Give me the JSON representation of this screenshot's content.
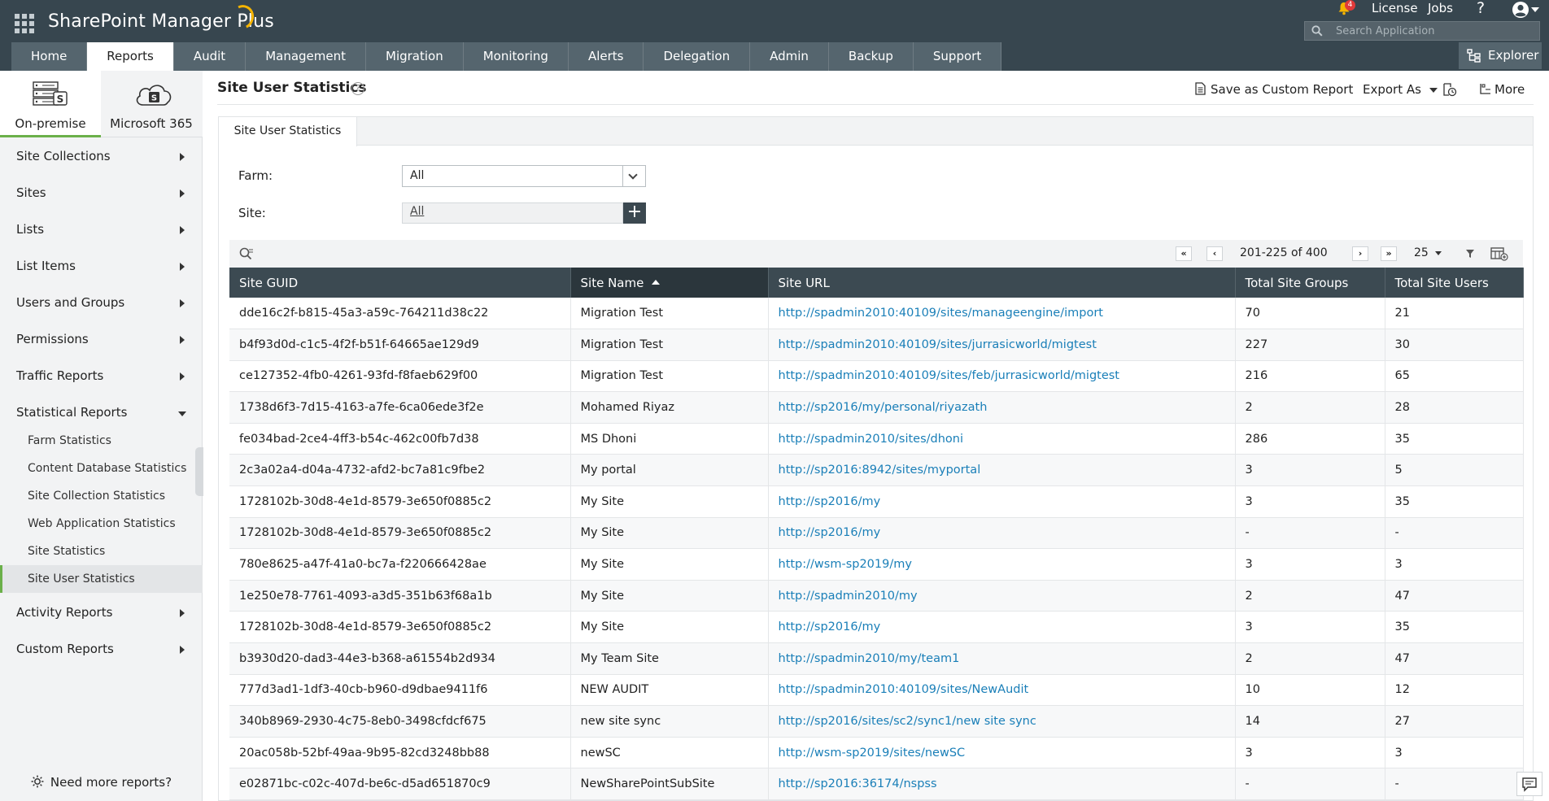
{
  "app": {
    "title": "SharePoint Manager Plus",
    "notification_count": "4",
    "license_label": "License",
    "jobs_label": "Jobs",
    "help_label": "?",
    "search_placeholder": "Search Application",
    "explorer_label": "Explorer"
  },
  "tabs": [
    "Home",
    "Reports",
    "Audit",
    "Management",
    "Migration",
    "Monitoring",
    "Alerts",
    "Delegation",
    "Admin",
    "Backup",
    "Support"
  ],
  "active_tab": "Reports",
  "sidebar": {
    "env_tabs": [
      "On-premise",
      "Microsoft 365"
    ],
    "items": [
      "Site Collections",
      "Sites",
      "Lists",
      "List Items",
      "Users and Groups",
      "Permissions",
      "Traffic Reports",
      "Statistical Reports"
    ],
    "sub_items": [
      "Farm Statistics",
      "Content Database Statistics",
      "Site Collection Statistics",
      "Web Application Statistics",
      "Site Statistics",
      "Site User Statistics"
    ],
    "active_sub_item": "Site User Statistics",
    "items_after": [
      "Activity Reports",
      "Custom Reports"
    ],
    "need_more": "Need more reports?"
  },
  "header": {
    "title": "Site User Statistics",
    "help": "?",
    "save_custom": "Save as Custom Report",
    "export_as": "Export As",
    "more": "More"
  },
  "panel_tab": "Site User Statistics",
  "filters": {
    "farm_label": "Farm:",
    "farm_value": "All",
    "site_label": "Site:",
    "site_value": "All",
    "add": "+"
  },
  "pagination": {
    "range": "201-225 of 400",
    "page_size": "25",
    "first": "«",
    "prev": "‹",
    "next": "›",
    "last": "»"
  },
  "table": {
    "columns": [
      "Site GUID",
      "Site Name",
      "Site URL",
      "Total Site Groups",
      "Total Site Users"
    ],
    "sorted_column": "Site Name",
    "rows": [
      [
        "dde16c2f-b815-45a3-a59c-764211d38c22",
        "Migration Test",
        "http://spadmin2010:40109/sites/manageengine/import",
        "70",
        "21"
      ],
      [
        "b4f93d0d-c1c5-4f2f-b51f-64665ae129d9",
        "Migration Test",
        "http://spadmin2010:40109/sites/jurrasicworld/migtest",
        "227",
        "30"
      ],
      [
        "ce127352-4fb0-4261-93fd-f8faeb629f00",
        "Migration Test",
        "http://spadmin2010:40109/sites/feb/jurrasicworld/migtest",
        "216",
        "65"
      ],
      [
        "1738d6f3-7d15-4163-a7fe-6ca06ede3f2e",
        "Mohamed Riyaz",
        "http://sp2016/my/personal/riyazath",
        "2",
        "28"
      ],
      [
        "fe034bad-2ce4-4ff3-b54c-462c00fb7d38",
        "MS Dhoni",
        "http://spadmin2010/sites/dhoni",
        "286",
        "35"
      ],
      [
        "2c3a02a4-d04a-4732-afd2-bc7a81c9fbe2",
        "My portal",
        "http://sp2016:8942/sites/myportal",
        "3",
        "5"
      ],
      [
        "1728102b-30d8-4e1d-8579-3e650f0885c2",
        "My Site",
        "http://sp2016/my",
        "3",
        "35"
      ],
      [
        "1728102b-30d8-4e1d-8579-3e650f0885c2",
        "My Site",
        "http://sp2016/my",
        "-",
        "-"
      ],
      [
        "780e8625-a47f-41a0-bc7a-f220666428ae",
        "My Site",
        "http://wsm-sp2019/my",
        "3",
        "3"
      ],
      [
        "1e250e78-7761-4093-a3d5-351b63f68a1b",
        "My Site",
        "http://spadmin2010/my",
        "2",
        "47"
      ],
      [
        "1728102b-30d8-4e1d-8579-3e650f0885c2",
        "My Site",
        "http://sp2016/my",
        "3",
        "35"
      ],
      [
        "b3930d20-dad3-44e3-b368-a61554b2d934",
        "My Team Site",
        "http://spadmin2010/my/team1",
        "2",
        "47"
      ],
      [
        "777d3ad1-1df3-40cb-b960-d9dbae9411f6",
        "NEW AUDIT",
        "http://spadmin2010:40109/sites/NewAudit",
        "10",
        "12"
      ],
      [
        "340b8969-2930-4c75-8eb0-3498cfdcf675",
        "new site sync",
        "http://sp2016/sites/sc2/sync1/new site sync",
        "14",
        "27"
      ],
      [
        "20ac058b-52bf-49aa-9b95-82cd3248bb88",
        "newSC",
        "http://wsm-sp2019/sites/newSC",
        "3",
        "3"
      ],
      [
        "e02871bc-c02c-407d-be6c-d5ad651870c9",
        "NewSharePointSubSite",
        "http://sp2016:36174/nspss",
        "-",
        "-"
      ]
    ]
  }
}
